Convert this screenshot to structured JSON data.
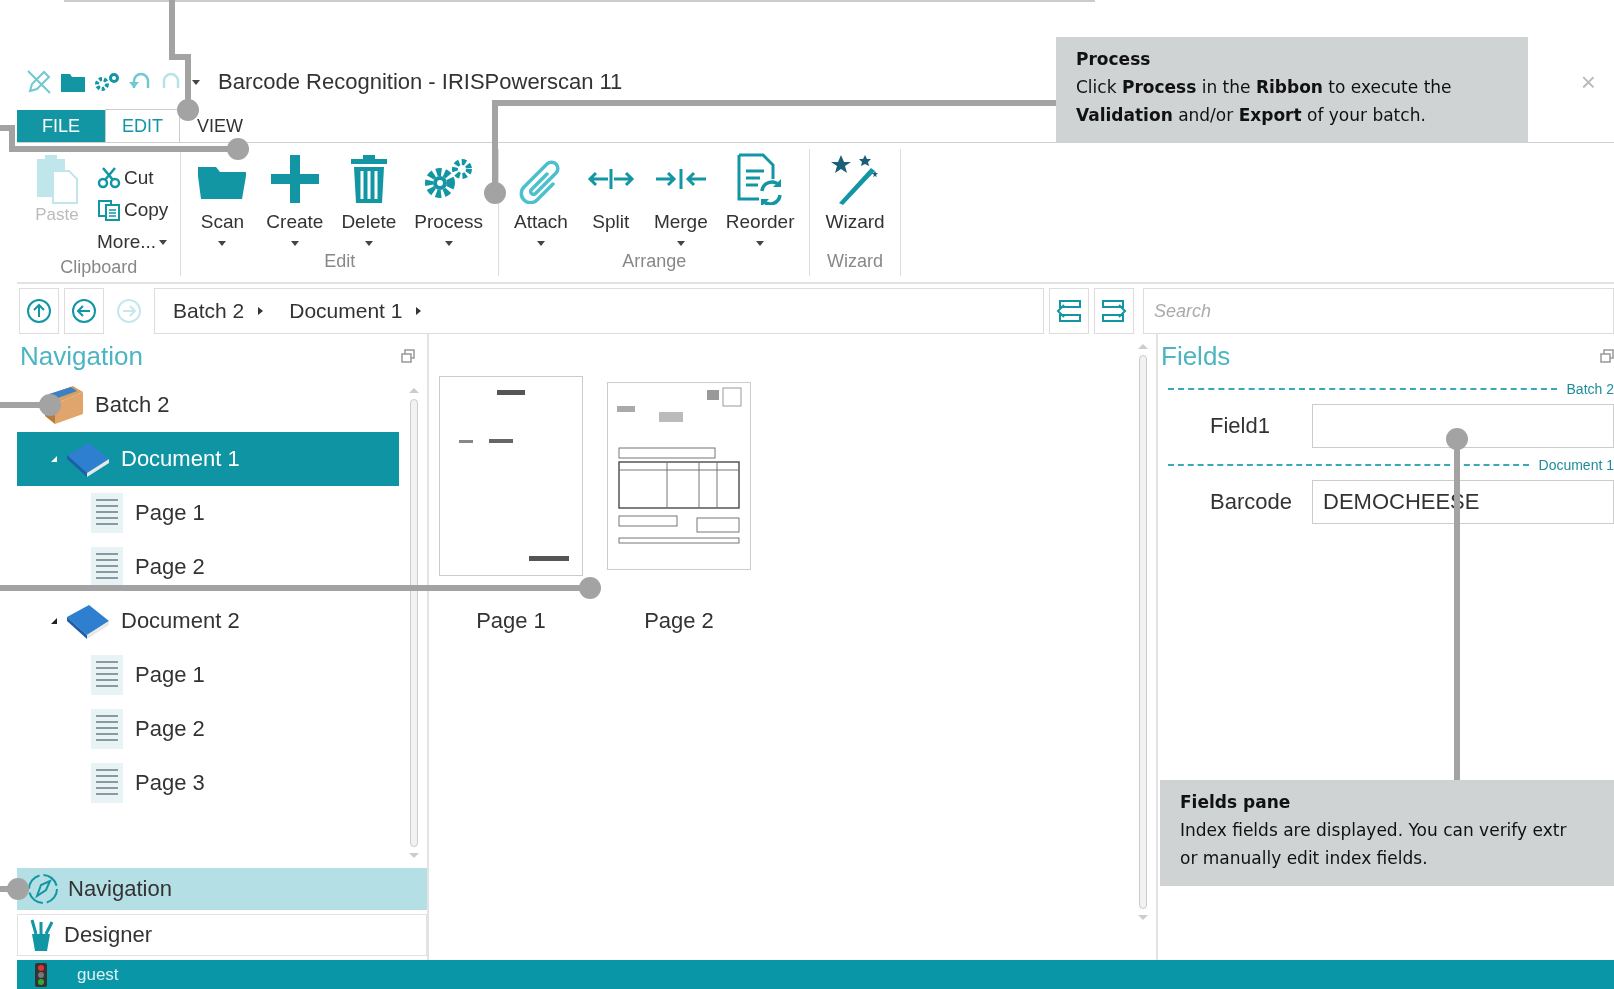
{
  "window": {
    "title": "Barcode Recognition - IRISPowerscan 11",
    "close": "×"
  },
  "tabs": [
    {
      "label": "FILE",
      "kind": "file",
      "selected": false
    },
    {
      "label": "EDIT",
      "kind": "tab",
      "selected": true
    },
    {
      "label": "VIEW",
      "kind": "tab",
      "selected": false
    }
  ],
  "ribbon": {
    "groups": [
      {
        "label": "Clipboard",
        "kind": "clipboard",
        "paste": {
          "label": "Paste",
          "disabled": true
        },
        "small": [
          {
            "label": "Cut",
            "dropdown": false
          },
          {
            "label": "Copy",
            "dropdown": false
          },
          {
            "label": "More...",
            "dropdown": true
          }
        ]
      },
      {
        "label": "Edit",
        "kind": "large",
        "buttons": [
          {
            "label": "Scan",
            "dropdown": true
          },
          {
            "label": "Create",
            "dropdown": true
          },
          {
            "label": "Delete",
            "dropdown": true
          },
          {
            "label": "Process",
            "dropdown": true
          }
        ]
      },
      {
        "label": "Arrange",
        "kind": "large",
        "buttons": [
          {
            "label": "Attach",
            "dropdown": true
          },
          {
            "label": "Split",
            "dropdown": false
          },
          {
            "label": "Merge",
            "dropdown": true
          },
          {
            "label": "Reorder",
            "dropdown": true
          }
        ]
      },
      {
        "label": "Wizard",
        "kind": "large",
        "buttons": [
          {
            "label": "Wizard",
            "dropdown": false
          }
        ]
      }
    ]
  },
  "breadcrumb": [
    "Batch 2",
    "Document 1"
  ],
  "forward_disabled": true,
  "search": {
    "placeholder": "Search"
  },
  "navigation": {
    "title": "Navigation",
    "tree": [
      {
        "label": "Batch 2",
        "expanded": true,
        "selected": false,
        "children": [
          {
            "label": "Document 1",
            "expanded": true,
            "selected": true,
            "children": [
              {
                "label": "Page 1",
                "selected": false
              },
              {
                "label": "Page 2",
                "selected": false
              }
            ]
          },
          {
            "label": "Document 2",
            "expanded": true,
            "selected": false,
            "children": [
              {
                "label": "Page 1",
                "selected": false
              },
              {
                "label": "Page 2",
                "selected": false
              },
              {
                "label": "Page 3",
                "selected": false
              }
            ]
          }
        ]
      }
    ],
    "sections": [
      {
        "label": "Navigation",
        "selected": true
      },
      {
        "label": "Designer",
        "selected": false
      }
    ]
  },
  "thumbnails": [
    {
      "label": "Page 1",
      "kind": "form"
    },
    {
      "label": "Page 2",
      "kind": "invoice"
    }
  ],
  "fields": {
    "title": "Fields",
    "groups": [
      {
        "label": "Batch 2",
        "fields": [
          {
            "label": "Field1"
          }
        ]
      },
      {
        "label": "Document 1",
        "fields": [
          {
            "label": "Barcode",
            "value": "DEMOCHEESE"
          }
        ]
      }
    ]
  },
  "status_bar": {
    "user": "guest"
  },
  "callouts": [
    {
      "title": "Process",
      "lines": [
        "Click **Process** in the **Ribbon** to execute the",
        "**Validation** and/or **Export** of your batch."
      ]
    },
    {
      "title": "Fields pane",
      "lines": [
        "Index fields are displayed. You can verify extr",
        "or manually edit index fields."
      ]
    }
  ]
}
